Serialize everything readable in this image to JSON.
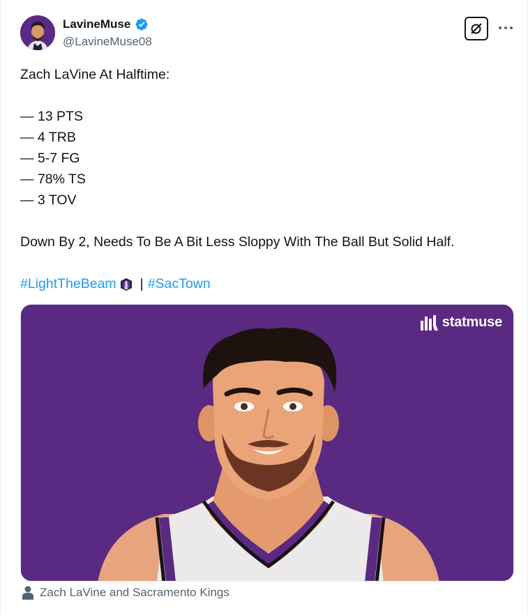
{
  "author": {
    "display_name": "LavineMuse",
    "handle": "@LavineMuse08",
    "verified": true,
    "avatar_icon": "avatar-portrait-icon"
  },
  "actions": {
    "grok_icon": "grok-icon",
    "more_icon": "more-horizontal-icon"
  },
  "tweet": {
    "title_line": "Zach LaVine At Halftime:",
    "stats": [
      "— 13 PTS",
      "— 4 TRB",
      "— 5-7 FG",
      "— 78% TS",
      "— 3 TOV"
    ],
    "comment": "Down By 2, Needs To Be A Bit Less Sloppy With The Ball But Solid Half.",
    "hashtag_1": "#LightTheBeam",
    "separator": "|",
    "hashtag_2": "#SacTown",
    "hashflag_icon": "kings-beam-hashflag-icon"
  },
  "media": {
    "logo_text": "statmuse",
    "logo_icon": "statmuse-logo-icon",
    "background_color": "#5a2a83"
  },
  "tagged": {
    "icon": "person-icon",
    "text": "Zach LaVine and Sacramento Kings"
  },
  "colors": {
    "link": "#1d9bf0",
    "verified": "#1d9bf0",
    "secondary_text": "#536471"
  }
}
